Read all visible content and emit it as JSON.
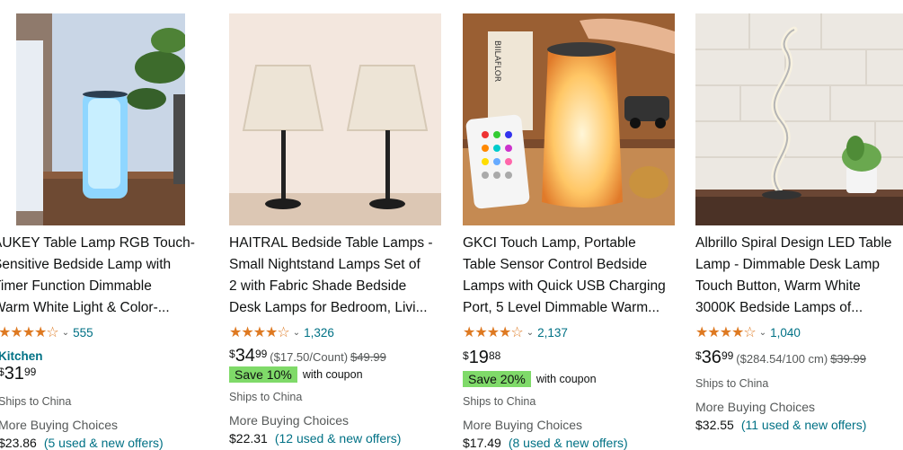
{
  "colors": {
    "star": "#de7921",
    "link": "#007185",
    "coupon_badge": "#7fda69",
    "muted": "#565959"
  },
  "products": [
    {
      "image_desc": "lamp",
      "title_lines": [
        "AUKEY Table Lamp RGB Touch-",
        "Sensitive Bedside Lamp with",
        "Timer Function Dimmable",
        "Warm White Light & Color-..."
      ],
      "stars": "★★★★☆",
      "stars_value": 4.5,
      "rating_count": "555",
      "store": "Kitchen",
      "price_symbol": "$",
      "price_whole": "31",
      "price_fraction": "99",
      "ships_to": "Ships to China",
      "more_buying": "More Buying Choices",
      "offer_price": "$23.86",
      "offer_link": "(5 used & new offers)"
    },
    {
      "title_lines": [
        "HAITRAL Bedside Table Lamps -",
        "Small Nightstand Lamps Set of",
        "2 with Fabric Shade Bedside",
        "Desk Lamps for Bedroom, Livi..."
      ],
      "stars": "★★★★☆",
      "stars_value": 4.5,
      "rating_count": "1,326",
      "price_symbol": "$",
      "price_whole": "34",
      "price_fraction": "99",
      "unit_price": "($17.50/Count)",
      "list_price": "$49.99",
      "coupon_badge": "Save 10%",
      "coupon_text": "with coupon",
      "ships_to": "Ships to China",
      "more_buying": "More Buying Choices",
      "offer_price": "$22.31",
      "offer_link": "(12 used & new offers)"
    },
    {
      "title_lines": [
        "GKCI Touch Lamp, Portable",
        "Table Sensor Control Bedside",
        "Lamps with Quick USB Charging",
        "Port, 5 Level Dimmable Warm..."
      ],
      "stars": "★★★★☆",
      "stars_value": 4.5,
      "rating_count": "2,137",
      "price_symbol": "$",
      "price_whole": "19",
      "price_fraction": "88",
      "coupon_badge": "Save 20%",
      "coupon_text": "with coupon",
      "ships_to": "Ships to China",
      "more_buying": "More Buying Choices",
      "offer_price": "$17.49",
      "offer_link": "(8 used & new offers)",
      "image_label": "BIILAFLOR"
    },
    {
      "title_lines": [
        "Albrillo Spiral Design LED Table",
        "Lamp - Dimmable Desk Lamp",
        "Touch Button, Warm White",
        "3000K Bedside Lamps of..."
      ],
      "stars": "★★★★☆",
      "stars_value": 4.5,
      "rating_count": "1,040",
      "price_symbol": "$",
      "price_whole": "36",
      "price_fraction": "99",
      "unit_price": "($284.54/100 cm)",
      "list_price": "$39.99",
      "ships_to": "Ships to China",
      "more_buying": "More Buying Choices",
      "offer_price": "$32.55",
      "offer_link": "(11 used & new offers)"
    }
  ]
}
